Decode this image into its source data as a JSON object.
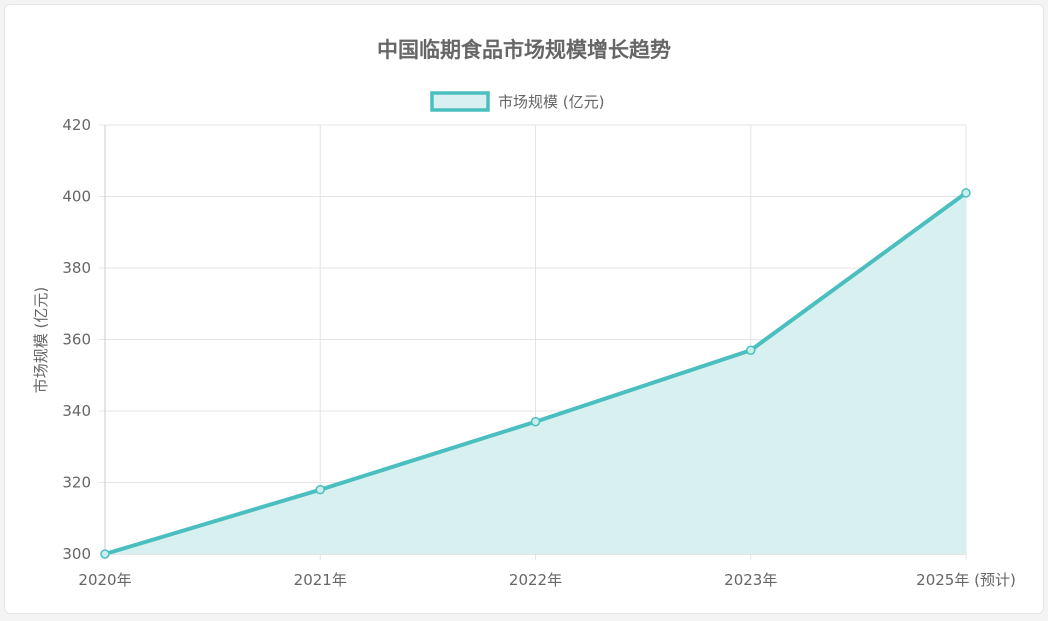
{
  "chart_data": {
    "type": "area",
    "title": "中国临期食品市场规模增长趋势",
    "ylabel": "市场规模 (亿元)",
    "xlabel": "",
    "categories": [
      "2020年",
      "2021年",
      "2022年",
      "2023年",
      "2025年 (预计)"
    ],
    "series": [
      {
        "name": "市场规模 (亿元)",
        "values": [
          300,
          318,
          337,
          357,
          401
        ]
      }
    ],
    "ylim": [
      300,
      420
    ],
    "yticks": [
      300,
      320,
      340,
      360,
      380,
      400,
      420
    ],
    "grid": true,
    "legend_position": "top-center",
    "colors": {
      "line": "#4bbfbf",
      "fill": "#d8f0f0",
      "grid": "#e5e5e5"
    }
  }
}
